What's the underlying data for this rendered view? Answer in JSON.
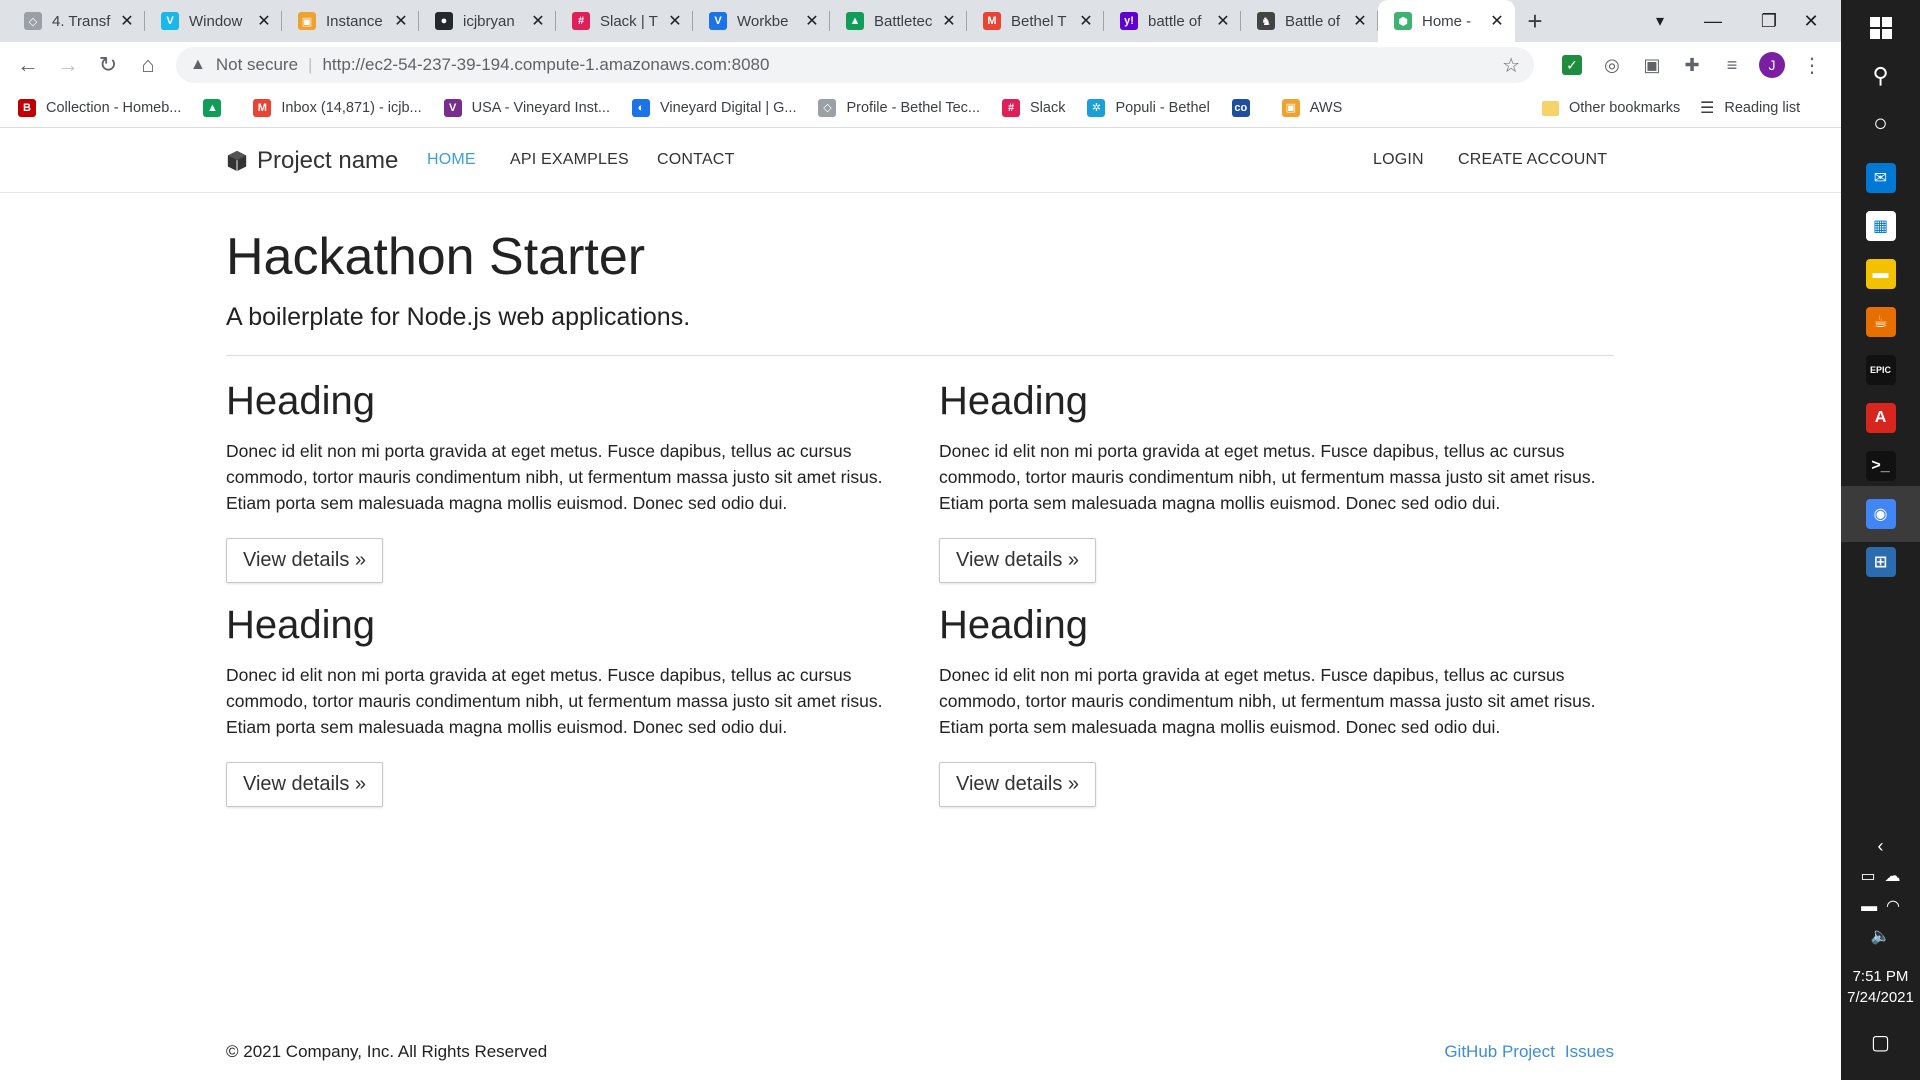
{
  "browser": {
    "tabs": [
      {
        "title": "4. Transf",
        "color": "#9aa0a6",
        "glyph": "◇"
      },
      {
        "title": "Window",
        "color": "#1ab7ea",
        "glyph": "V"
      },
      {
        "title": "Instance",
        "color": "#f0a22e",
        "glyph": "▣"
      },
      {
        "title": "icjbryan",
        "color": "#24292e",
        "glyph": "●"
      },
      {
        "title": "Slack | T",
        "color": "#e01e5a",
        "glyph": "#"
      },
      {
        "title": "Workbe",
        "color": "#1a73e8",
        "glyph": "V"
      },
      {
        "title": "Battletec",
        "color": "#0f9d58",
        "glyph": "▲"
      },
      {
        "title": "Bethel T",
        "color": "#ea4335",
        "glyph": "M"
      },
      {
        "title": "battle of",
        "color": "#6001d2",
        "glyph": "y!"
      },
      {
        "title": "Battle of",
        "color": "#444444",
        "glyph": "♞"
      },
      {
        "title": "Home -",
        "color": "#3cb371",
        "glyph": "⬢"
      }
    ],
    "active_tab_index": 10,
    "address": {
      "security_label": "Not secure",
      "url": "http://ec2-54-237-39-194.compute-1.amazonaws.com:8080"
    },
    "bookmarks": [
      {
        "label": "Collection - Homeb...",
        "color": "#c00000",
        "glyph": "B"
      },
      {
        "label": "",
        "color": "#0f9d58",
        "glyph": "▲"
      },
      {
        "label": "Inbox (14,871) - icjb...",
        "color": "#ea4335",
        "glyph": "M"
      },
      {
        "label": "USA - Vineyard Inst...",
        "color": "#7b2d8e",
        "glyph": "V"
      },
      {
        "label": "Vineyard Digital | G...",
        "color": "#1a73e8",
        "glyph": "◐"
      },
      {
        "label": "Profile - Bethel Tec...",
        "color": "#9aa0a6",
        "glyph": "◇"
      },
      {
        "label": "Slack",
        "color": "#e01e5a",
        "glyph": "#"
      },
      {
        "label": "Populi - Bethel",
        "color": "#1a9fd6",
        "glyph": "✲"
      },
      {
        "label": "",
        "color": "#1f4e9c",
        "glyph": "co"
      },
      {
        "label": "AWS",
        "color": "#f0a22e",
        "glyph": "▣"
      }
    ],
    "other_bookmarks": "Other bookmarks",
    "reading_list": "Reading list",
    "profile_initial": "J"
  },
  "site": {
    "brand": "Project name",
    "nav": [
      {
        "label": "HOME",
        "active": true
      },
      {
        "label": "API EXAMPLES",
        "active": false
      },
      {
        "label": "CONTACT",
        "active": false
      }
    ],
    "nav_right": {
      "login": "LOGIN",
      "create_account": "CREATE ACCOUNT"
    },
    "jumbotron": {
      "title": "Hackathon Starter",
      "subtitle": "A boilerplate for Node.js web applications."
    },
    "cards": [
      {
        "heading": "Heading",
        "body": "Donec id elit non mi porta gravida at eget metus. Fusce dapibus, tellus ac cursus commodo, tortor mauris condimentum nibh, ut fermentum massa justo sit amet risus. Etiam porta sem malesuada magna mollis euismod. Donec sed odio dui.",
        "button": "View details »"
      },
      {
        "heading": "Heading",
        "body": "Donec id elit non mi porta gravida at eget metus. Fusce dapibus, tellus ac cursus commodo, tortor mauris condimentum nibh, ut fermentum massa justo sit amet risus. Etiam porta sem malesuada magna mollis euismod. Donec sed odio dui.",
        "button": "View details »"
      },
      {
        "heading": "Heading",
        "body": "Donec id elit non mi porta gravida at eget metus. Fusce dapibus, tellus ac cursus commodo, tortor mauris condimentum nibh, ut fermentum massa justo sit amet risus. Etiam porta sem malesuada magna mollis euismod. Donec sed odio dui.",
        "button": "View details »"
      },
      {
        "heading": "Heading",
        "body": "Donec id elit non mi porta gravida at eget metus. Fusce dapibus, tellus ac cursus commodo, tortor mauris condimentum nibh, ut fermentum massa justo sit amet risus. Etiam porta sem malesuada magna mollis euismod. Donec sed odio dui.",
        "button": "View details »"
      }
    ],
    "footer": {
      "copyright": "© 2021 Company, Inc. All Rights Reserved",
      "links": [
        "GitHub Project",
        "Issues"
      ]
    },
    "colors": {
      "link": "#3e9fd8",
      "text": "#222222"
    }
  },
  "taskbar": {
    "apps": [
      {
        "name": "mail",
        "color": "#0078d4",
        "glyph": "✉"
      },
      {
        "name": "store",
        "color": "#ffffff",
        "glyph": "▦"
      },
      {
        "name": "file-explorer",
        "color": "#f2c200",
        "glyph": "▬"
      },
      {
        "name": "java",
        "color": "#e76f00",
        "glyph": "☕"
      },
      {
        "name": "epic-games",
        "color": "#111111",
        "glyph": "EPIC"
      },
      {
        "name": "acrobat",
        "color": "#d7261e",
        "glyph": "A"
      },
      {
        "name": "terminal",
        "color": "#111111",
        "glyph": ">_"
      },
      {
        "name": "chrome",
        "color": "#4285f4",
        "glyph": "◉"
      },
      {
        "name": "network",
        "color": "#2b6cb0",
        "glyph": "⊞"
      }
    ],
    "time": "7:51 PM",
    "date": "7/24/2021"
  }
}
